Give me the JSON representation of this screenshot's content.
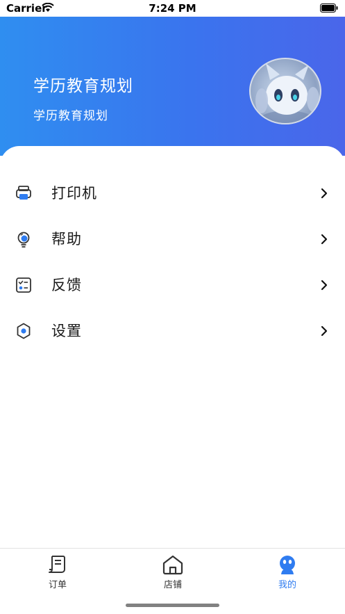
{
  "status_bar": {
    "carrier": "Carrier",
    "time": "7:24 PM"
  },
  "header": {
    "title": "学历教育规划",
    "subtitle": "学历教育规划"
  },
  "menu": {
    "items": [
      {
        "label": "打印机",
        "icon": "printer-icon"
      },
      {
        "label": "帮助",
        "icon": "lightbulb-icon"
      },
      {
        "label": "反馈",
        "icon": "checklist-icon"
      },
      {
        "label": "设置",
        "icon": "gear-icon"
      }
    ]
  },
  "tabbar": {
    "items": [
      {
        "label": "订单",
        "icon": "order-icon",
        "active": false
      },
      {
        "label": "店铺",
        "icon": "store-icon",
        "active": false
      },
      {
        "label": "我的",
        "icon": "profile-icon",
        "active": true
      }
    ]
  },
  "colors": {
    "accent": "#2f7cf0",
    "header_gradient_start": "#2f8ef0",
    "header_gradient_end": "#4a66ea"
  }
}
